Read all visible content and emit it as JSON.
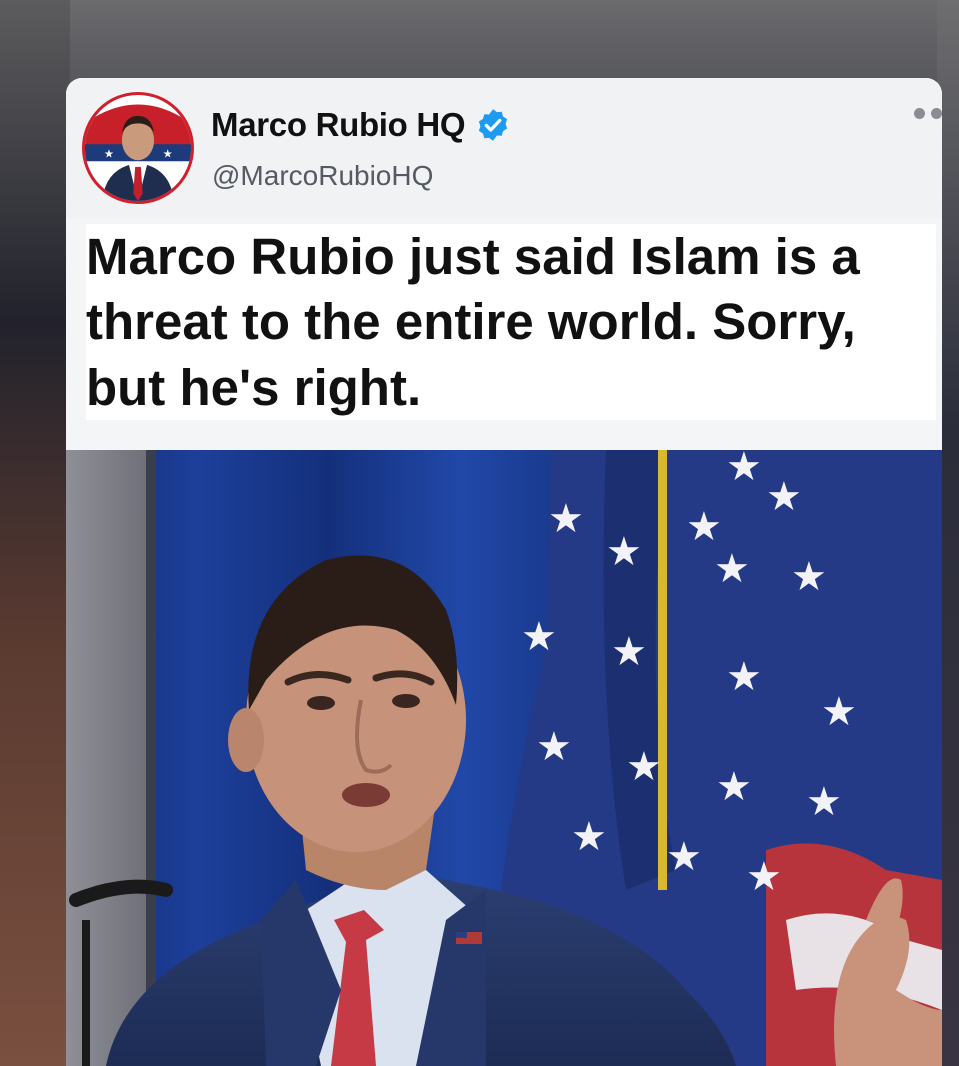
{
  "tweet": {
    "display_name": "Marco Rubio HQ",
    "handle": "@MarcoRubioHQ",
    "verified_icon": "verified-badge-icon",
    "more_icon": "more-options-icon",
    "text": "Marco Rubio just said Islam is a threat to the entire world. Sorry, but he's right."
  },
  "photo": {
    "description_icon": "photo-of-speaker-at-podium-with-flag"
  },
  "colors": {
    "verified_blue": "#1d9bf0",
    "card_bg": "#f4f5f7",
    "text": "#111111",
    "handle_gray": "#555a62"
  }
}
